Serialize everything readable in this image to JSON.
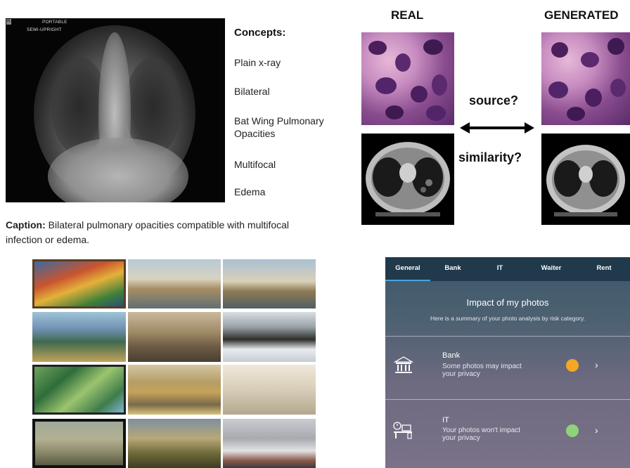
{
  "xray": {
    "label_portable": "PORTABLE",
    "label_semi": "SEMI-UPRIGHT",
    "marker": "R"
  },
  "concepts": {
    "title": "Concepts:",
    "items": [
      "Plain x-ray",
      "Bilateral",
      "Bat Wing Pulmonary Opacities",
      "Multifocal",
      "Edema"
    ]
  },
  "caption": {
    "label": "Caption:",
    "text": " Bilateral pulmonary opacities compatible with multifocal infection or edema."
  },
  "comparison": {
    "real": "REAL",
    "generated": "GENERATED",
    "q_source": "source?",
    "q_similarity": "similarity?"
  },
  "phone": {
    "tabs": [
      "General",
      "Bank",
      "IT",
      "Waiter",
      "Rent"
    ],
    "active_tab": "General",
    "title": "Impact of my photos",
    "subtitle": "Here is a summary of your photo analysis by risk category.",
    "rows": [
      {
        "name": "Bank",
        "desc_line1": "Some photos may impact",
        "desc_line2": "your privacy",
        "status_color": "#f5a623",
        "icon": "bank-icon"
      },
      {
        "name": "IT",
        "desc_line1": "Your photos won't impact",
        "desc_line2": "your privacy",
        "status_color": "#8fd27a",
        "icon": "office-desk-icon"
      }
    ]
  }
}
